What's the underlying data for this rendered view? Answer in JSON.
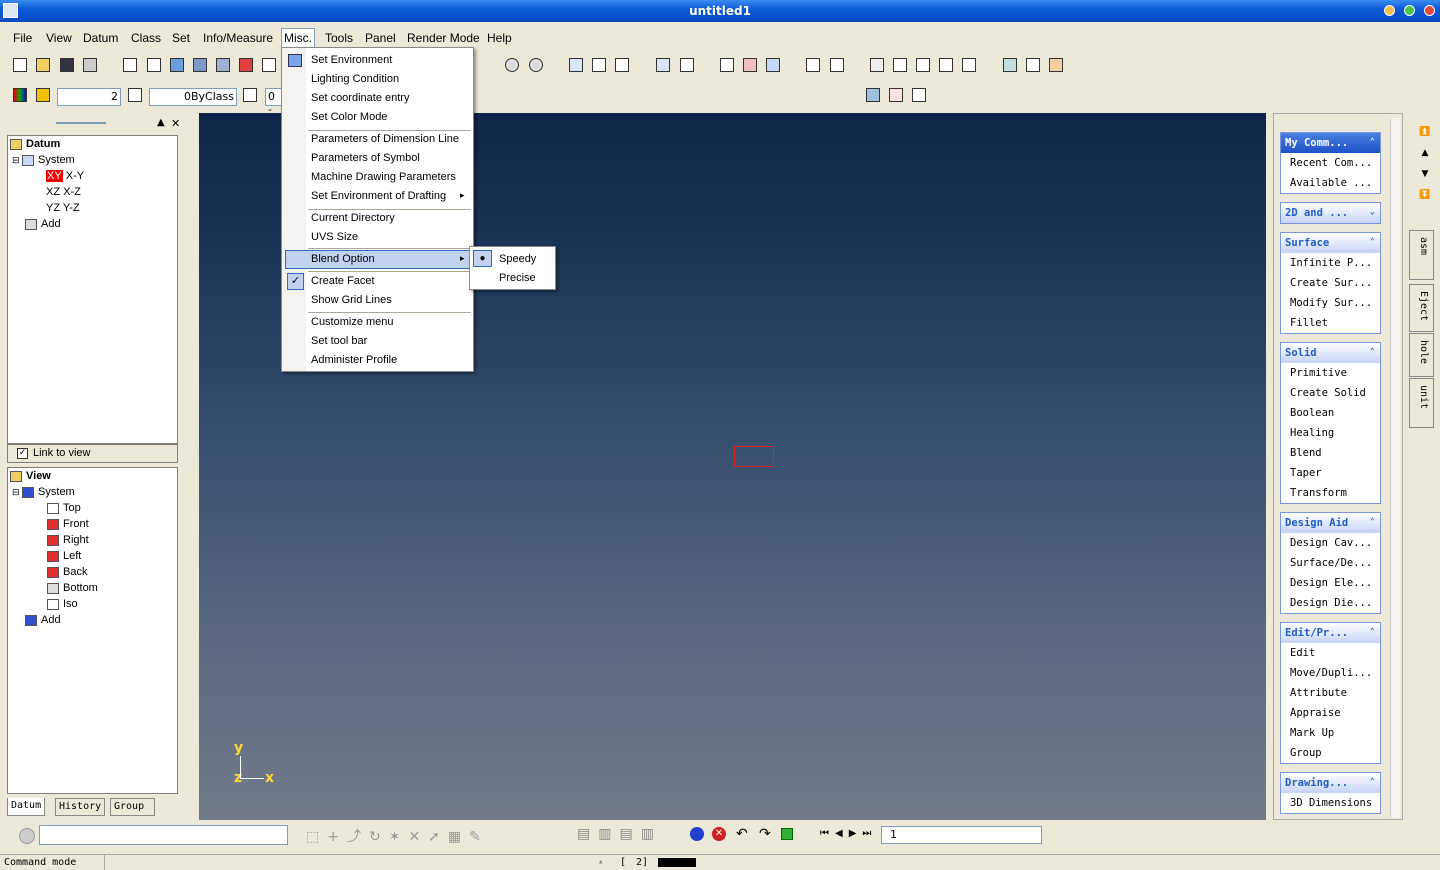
{
  "window": {
    "title": "untitled1"
  },
  "menubar": [
    "File",
    "View",
    "Datum",
    "Class",
    "Set",
    "Info/Measure",
    "Misc.",
    "Tools",
    "Panel",
    "Render Mode",
    "Help"
  ],
  "toolbar2": {
    "line_width": "2",
    "class_combo": "0ByClass",
    "level_combo": "0 -"
  },
  "datum_panel": {
    "root": "Datum",
    "system": "System",
    "items": [
      {
        "tag": "XY",
        "label": "X-Y"
      },
      {
        "tag": "XZ",
        "label": "X-Z"
      },
      {
        "tag": "YZ",
        "label": "Y-Z"
      }
    ],
    "add": "Add",
    "link_to_view": "Link to view"
  },
  "view_panel": {
    "root": "View",
    "system": "System",
    "items": [
      "Top",
      "Front",
      "Right",
      "Left",
      "Back",
      "Bottom",
      "Iso"
    ],
    "add": "Add"
  },
  "bottom_tabs": [
    "Datum",
    "History",
    "Group"
  ],
  "misc_menu": {
    "items": [
      "Set Environment",
      "Lighting Condition",
      "Set coordinate entry",
      "Set Color Mode",
      "Parameters of Dimension Line",
      "Parameters of Symbol",
      "Machine Drawing Parameters",
      "Set Environment of Drafting",
      "Current Directory",
      "UVS Size",
      "Blend Option",
      "Create Facet",
      "Show Grid Lines",
      "Customize menu",
      "Set tool bar",
      "Administer Profile"
    ],
    "submenu": [
      "Speedy",
      "Precise"
    ]
  },
  "axis": {
    "y": "y",
    "z": "z",
    "x": "x"
  },
  "right_panel": {
    "groups": [
      {
        "title": "My Comm...",
        "items": [
          "Recent Com...",
          "Available ..."
        ],
        "expanded": true
      },
      {
        "title": "2D and ...",
        "items": [],
        "expanded": false
      },
      {
        "title": "Surface",
        "items": [
          "Infinite P...",
          "Create Sur...",
          "Modify Sur...",
          "Fillet"
        ],
        "expanded": true
      },
      {
        "title": "Solid",
        "items": [
          "Primitive",
          "Create Solid",
          "Boolean",
          "Healing",
          "Blend",
          "Taper",
          "Transform"
        ],
        "expanded": true
      },
      {
        "title": "Design Aid",
        "items": [
          "Design Cav...",
          "Surface/De...",
          "Design Ele...",
          "Design Die..."
        ],
        "expanded": true
      },
      {
        "title": "Edit/Pr...",
        "items": [
          "Edit",
          "Move/Dupli...",
          "Attribute",
          "Appraise",
          "Mark Up",
          "Group"
        ],
        "expanded": true
      },
      {
        "title": "Drawing...",
        "items": [
          "3D Dimensions"
        ],
        "expanded": true
      }
    ],
    "side_tabs": [
      "asm",
      "Eject",
      "hole",
      "unit"
    ]
  },
  "cmdbar": {
    "page": "1"
  },
  "status": {
    "mode": "Command mode",
    "bracket": "[",
    "num": "2]"
  }
}
